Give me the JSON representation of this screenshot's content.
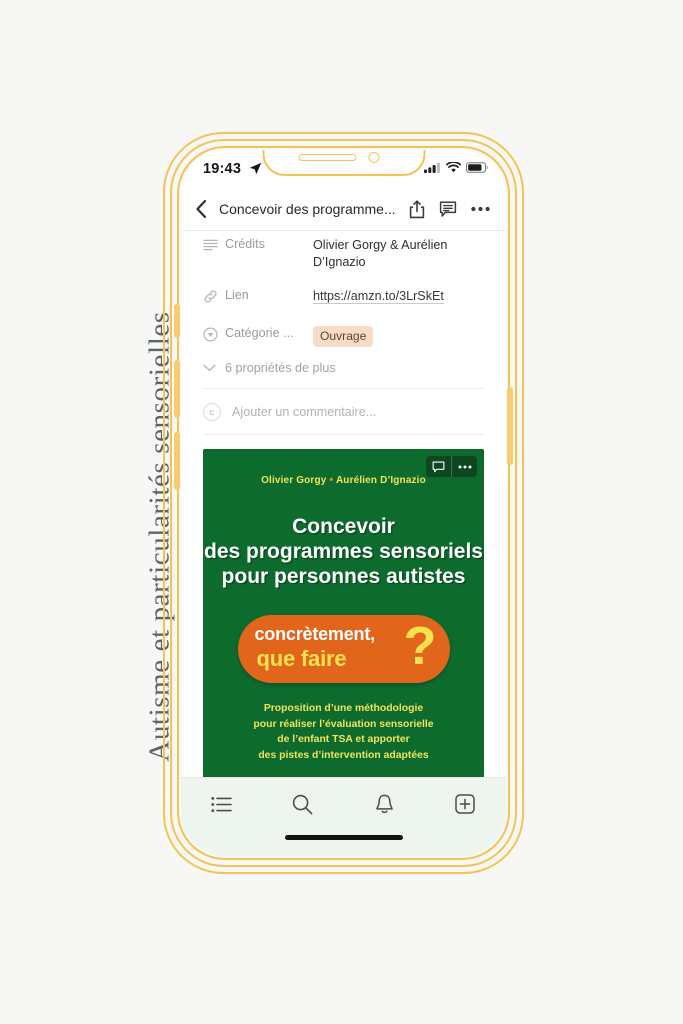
{
  "side_caption": "Autisme et particularités sensorielles",
  "colors": {
    "frame": "#f5c354",
    "cover_green": "#0d6b2e",
    "cover_orange": "#e2651c",
    "cover_yellow": "#f2e35c",
    "badge_bg": "#f7ddc8",
    "badge_text": "#66422a"
  },
  "status_bar": {
    "time": "19:43",
    "location_icon": "location-arrow-icon",
    "cellular_icon": "cellular-bars-icon",
    "wifi_icon": "wifi-icon",
    "battery_icon": "battery-icon"
  },
  "nav_bar": {
    "back_icon": "chevron-left-icon",
    "title": "Concevoir des programme...",
    "share_icon": "share-icon",
    "comment_icon": "comment-bubble-icon",
    "more_icon": "ellipsis-icon"
  },
  "properties": [
    {
      "icon": "text-lines-icon",
      "label": "Crédits",
      "value": "Olivier Gorgy & Aurélien D’Ignazio",
      "type": "text"
    },
    {
      "icon": "link-icon",
      "label": "Lien",
      "value": "https://amzn.to/3LrSkEt",
      "type": "link"
    },
    {
      "icon": "select-circle-icon",
      "label": "Catégorie ...",
      "value": "Ouvrage",
      "type": "badge"
    }
  ],
  "more_properties": {
    "icon": "chevron-down-icon",
    "label": "6 propriétés de plus"
  },
  "comment": {
    "avatar_initial": "C",
    "placeholder": "Ajouter un commentaire..."
  },
  "book_cover": {
    "authors_left": "Olivier Gorgy",
    "authors_separator": "•",
    "authors_right": "Aurélien D’Ignazio",
    "title_line1": "Concevoir",
    "title_line2": "des programmes sensoriels",
    "title_line3": "pour personnes autistes",
    "blob_line1": "concrètement,",
    "blob_line2": "que faire",
    "blob_mark": "?",
    "subtitle_line1": "Proposition d’une méthodologie",
    "subtitle_line2": "pour réaliser l’évaluation sensorielle",
    "subtitle_line3": "de l’enfant TSA et apporter",
    "subtitle_line4": "des pistes d’intervention adaptées",
    "toolbar": {
      "comment_icon": "comment-bubble-icon",
      "more_icon": "ellipsis-icon"
    }
  },
  "tab_bar": [
    {
      "icon": "list-icon",
      "name": "tab-list"
    },
    {
      "icon": "search-icon",
      "name": "tab-search"
    },
    {
      "icon": "bell-icon",
      "name": "tab-notifications"
    },
    {
      "icon": "plus-square-icon",
      "name": "tab-create"
    }
  ]
}
